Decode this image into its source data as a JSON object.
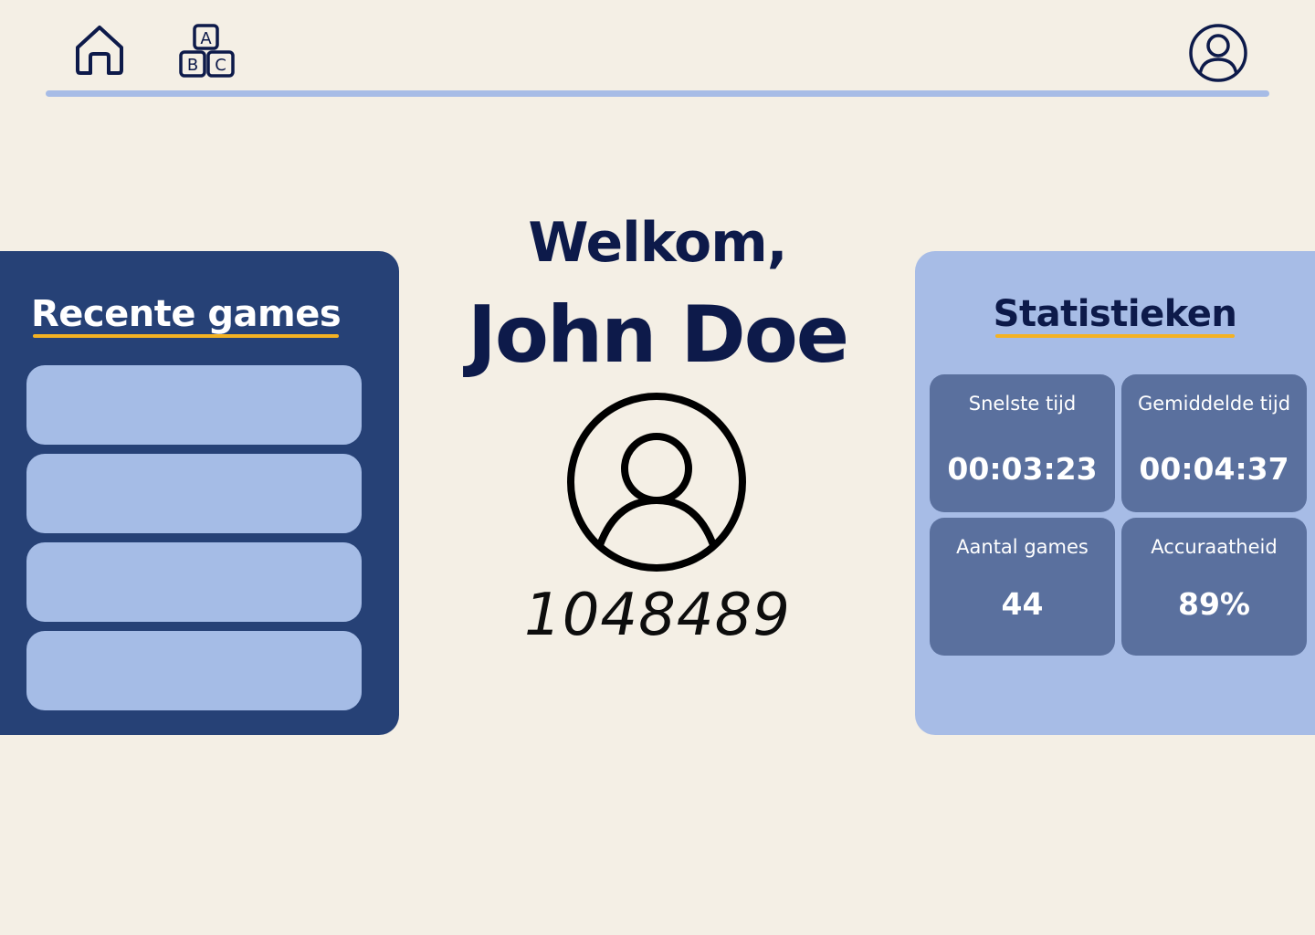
{
  "nav": {
    "icons": [
      "home-icon",
      "abc-blocks-icon",
      "user-profile-icon"
    ],
    "abc_letters": [
      "A",
      "B",
      "C"
    ]
  },
  "recent_games": {
    "title": "Recente games",
    "items": [
      "",
      "",
      "",
      ""
    ]
  },
  "welcome": {
    "greeting": "Welkom,",
    "name": "John Doe",
    "user_id": "1048489"
  },
  "statistics": {
    "title": "Statistieken",
    "cards": [
      {
        "label": "Snelste tijd",
        "value": "00:03:23"
      },
      {
        "label": "Gemiddelde tijd",
        "value": "00:04:37"
      },
      {
        "label": "Aantal games",
        "value": "44"
      },
      {
        "label": "Accuraatheid",
        "value": "89%"
      }
    ]
  },
  "colors": {
    "background": "#f4efe5",
    "navy": "#0d1a4a",
    "recent_panel": "#264176",
    "light_blue": "#a7bce6",
    "stat_card": "#5a709e",
    "accent_underline": "#f4b223"
  }
}
